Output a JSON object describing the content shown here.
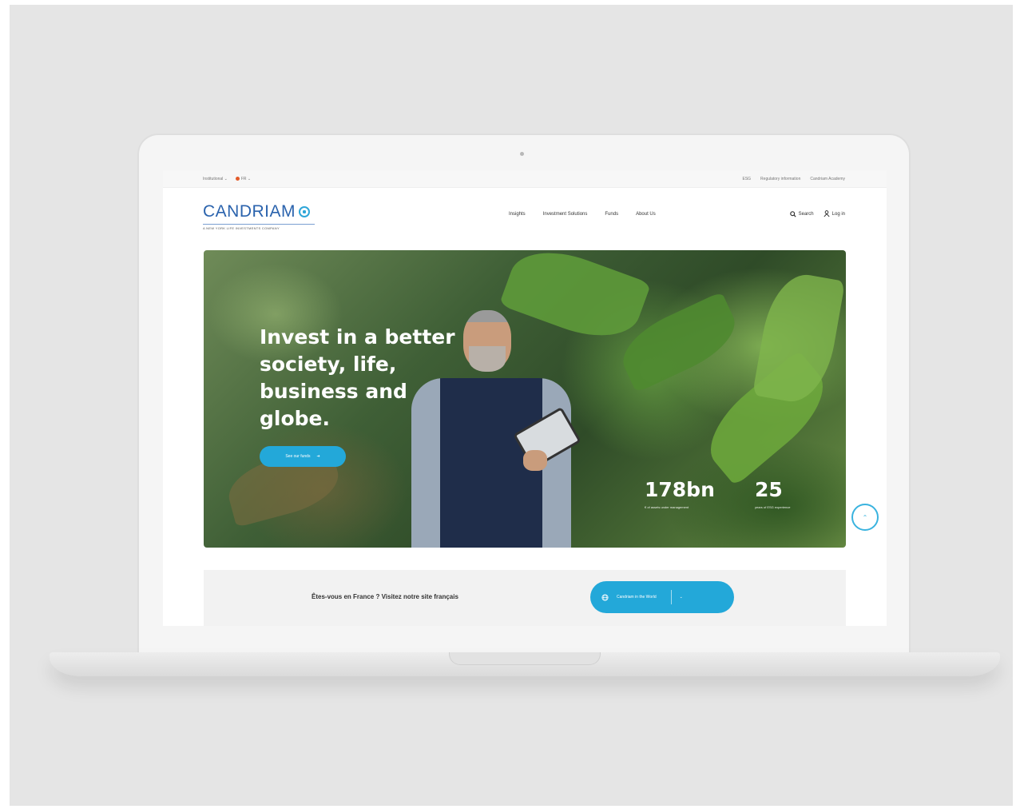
{
  "utility_bar": {
    "audience": "Institutional ⌄",
    "language": "FR ⌄",
    "links": [
      "ESG",
      "Regulatory information",
      "Candriam Academy"
    ]
  },
  "header": {
    "logo_text": "CANDRIAM",
    "logo_tagline": "A NEW YORK LIFE INVESTMENTS COMPANY",
    "nav": [
      "Insights",
      "Investment Solutions",
      "Funds",
      "About Us"
    ],
    "search_label": "Search",
    "login_label": "Log in"
  },
  "hero": {
    "title": "Invest in a better\nsociety, life,\nbusiness and\nglobe.",
    "button_label": "See our funds",
    "stats": [
      {
        "value": "178bn",
        "label": "€ of assets under management"
      },
      {
        "value": "25",
        "label": "years of ESG experience"
      }
    ]
  },
  "banner": {
    "text": "Êtes-vous en France ? Visitez notre site français",
    "button_label": "Candriam in the World"
  },
  "colors": {
    "brand_blue": "#2b63ad",
    "accent_cyan": "#23a8d9",
    "background_gray": "#e5e5e5"
  }
}
